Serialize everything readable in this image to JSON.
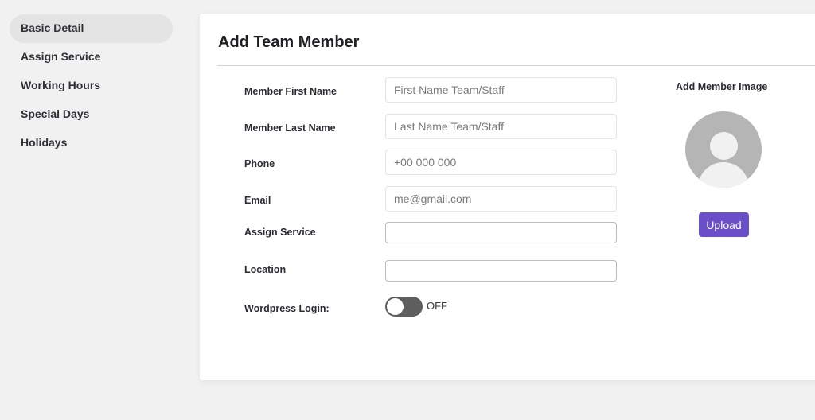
{
  "sidebar": {
    "items": [
      {
        "label": "Basic Detail",
        "active": true
      },
      {
        "label": "Assign Service",
        "active": false
      },
      {
        "label": "Working Hours",
        "active": false
      },
      {
        "label": "Special Days",
        "active": false
      },
      {
        "label": "Holidays",
        "active": false
      }
    ]
  },
  "card": {
    "title": "Add Team Member"
  },
  "form": {
    "first_name": {
      "label": "Member First Name",
      "placeholder": "First Name Team/Staff",
      "value": ""
    },
    "last_name": {
      "label": "Member Last Name",
      "placeholder": "Last Name Team/Staff",
      "value": ""
    },
    "phone": {
      "label": "Phone",
      "placeholder": "+00 000 000",
      "value": ""
    },
    "email": {
      "label": "Email",
      "placeholder": "me@gmail.com",
      "value": ""
    },
    "assign_service": {
      "label": "Assign Service",
      "value": ""
    },
    "location": {
      "label": "Location",
      "value": ""
    },
    "wordpress_login": {
      "label": "Wordpress Login:",
      "state": "OFF"
    }
  },
  "member_image": {
    "title": "Add Member Image",
    "icon": "user-avatar-placeholder-icon",
    "upload_label": "Upload"
  },
  "colors": {
    "accent": "#6a4fc8",
    "toggle_off": "#5e5e5e",
    "sidebar_active": "#e4e4e4"
  }
}
